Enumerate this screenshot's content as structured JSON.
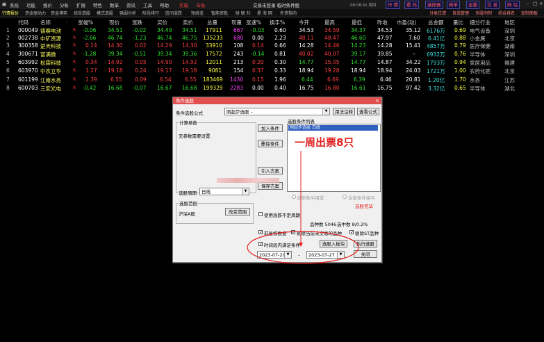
{
  "menu": {
    "items": [
      "系统",
      "功能",
      "报价",
      "分析",
      "扩展",
      "特色",
      "数单",
      "资讯",
      "工具",
      "帮助"
    ],
    "highlight": [
      "实现",
      "市场"
    ],
    "title": "交易未登录 临时条件股",
    "time": "08:08:41 周四",
    "buttons": [
      "行 情",
      "委 托",
      "选择器",
      "新单",
      "全量",
      "交 易",
      "网 站"
    ]
  },
  "tabs": {
    "left": [
      "行情报价",
      "资金驱动力",
      "资金博弈",
      "综合选股",
      "模式选股",
      "强弱分析",
      "阶段排行",
      "区间涨跌",
      "短线宝",
      "智能审批",
      "财 联 社",
      "星 海 网",
      "外资指向"
    ],
    "right": [
      "分类过滤",
      "自选管理",
      "多股同列",
      "综合排名",
      "定制面板"
    ]
  },
  "table": {
    "headers": [
      "代码",
      "名称",
      "·",
      "涨幅%",
      "现价",
      "涨跌",
      "买价",
      "卖价",
      "总量",
      "现量",
      "涨速%",
      "换手%",
      "今开",
      "最高",
      "最低",
      "昨收",
      "市盈(动)",
      "总金额",
      "量比",
      "细分行业",
      "地区"
    ],
    "rows": [
      {
        "idx": "1",
        "code": "000049",
        "name": "德赛电池",
        "r": "R",
        "chg_pct": "-0.06",
        "price": "34.51",
        "chg": "-0.02",
        "bid": "34.49",
        "ask": "34.51",
        "vol": "17911",
        "cur": "667",
        "speed": "-0.03",
        "turnover": "0.60",
        "open": "34.53",
        "high": "34.59",
        "low": "34.37",
        "prev": "34.53",
        "pe": "35.12",
        "amount": "6176万",
        "vr": "0.69",
        "industry": "电气设备",
        "region": "深圳"
      },
      {
        "idx": "2",
        "code": "002738",
        "name": "中矿资源",
        "r": "R",
        "chg_pct": "-2.66",
        "price": "46.74",
        "chg": "-1.23",
        "bid": "46.74",
        "ask": "46.75",
        "vol": "135233",
        "cur": "680",
        "speed": "0.00",
        "turnover": "2.23",
        "open": "48.11",
        "high": "48.47",
        "low": "46.60",
        "prev": "47.97",
        "pe": "7.60",
        "amount": "6.41亿",
        "vr": "0.88",
        "industry": "小金属",
        "region": "北京"
      },
      {
        "idx": "3",
        "code": "300358",
        "name": "楚天科技",
        "r": "R",
        "chg_pct": "0.14",
        "price": "14.30",
        "chg": "0.02",
        "bid": "14.29",
        "ask": "14.30",
        "vol": "33910",
        "cur": "108",
        "speed": "0.14",
        "turnover": "0.66",
        "open": "14.28",
        "high": "14.46",
        "low": "14.23",
        "prev": "14.28",
        "pe": "15.41",
        "amount": "4857万",
        "vr": "0.79",
        "industry": "医疗保健",
        "region": "湖南"
      },
      {
        "idx": "4",
        "code": "300671",
        "name": "富满微",
        "r": "R",
        "chg_pct": "-1.28",
        "price": "39.34",
        "chg": "-0.51",
        "bid": "39.34",
        "ask": "39.36",
        "vol": "17572",
        "cur": "243",
        "speed": "-0.14",
        "turnover": "0.81",
        "open": "40.02",
        "high": "40.07",
        "low": "39.17",
        "prev": "39.85",
        "pe": "–",
        "amount": "6932万",
        "vr": "0.76",
        "industry": "半导体",
        "region": "深圳"
      },
      {
        "idx": "5",
        "code": "603992",
        "name": "松霖科技",
        "r": "R",
        "chg_pct": "0.34",
        "price": "14.92",
        "chg": "0.05",
        "bid": "14.90",
        "ask": "14.92",
        "vol": "12011",
        "cur": "213",
        "speed": "0.20",
        "turnover": "0.30",
        "open": "14.77",
        "high": "15.05",
        "low": "14.77",
        "prev": "14.87",
        "pe": "34.22",
        "amount": "1793万",
        "vr": "0.94",
        "industry": "家居用品",
        "region": "福建"
      },
      {
        "idx": "6",
        "code": "603970",
        "name": "中农立华",
        "r": "R",
        "chg_pct": "1.27",
        "price": "19.18",
        "chg": "0.24",
        "bid": "19.17",
        "ask": "19.18",
        "vol": "9081",
        "cur": "154",
        "speed": "0.37",
        "turnover": "0.33",
        "open": "18.94",
        "high": "19.28",
        "low": "18.94",
        "prev": "18.94",
        "pe": "24.03",
        "amount": "1721万",
        "vr": "1.00",
        "industry": "农药化肥",
        "region": "北京"
      },
      {
        "idx": "7",
        "code": "601199",
        "name": "江南水务",
        "r": "R",
        "chg_pct": "1.39",
        "price": "6.55",
        "chg": "0.09",
        "bid": "6.54",
        "ask": "6.55",
        "vol": "183469",
        "cur": "1430",
        "speed": "0.15",
        "turnover": "1.96",
        "open": "6.44",
        "high": "6.69",
        "low": "6.39",
        "prev": "6.46",
        "pe": "20.81",
        "amount": "1.20亿",
        "vr": "1.70",
        "industry": "水务",
        "region": "江苏"
      },
      {
        "idx": "8",
        "code": "600703",
        "name": "三安光电",
        "r": "R",
        "chg_pct": "-0.42",
        "price": "16.68",
        "chg": "-0.07",
        "bid": "16.67",
        "ask": "16.68",
        "vol": "199329",
        "cur": "2283",
        "speed": "0.00",
        "turnover": "0.40",
        "open": "16.75",
        "high": "16.80",
        "low": "16.61",
        "prev": "16.75",
        "pe": "97.42",
        "amount": "3.32亿",
        "vr": "0.65",
        "industry": "半导体",
        "region": "湖北"
      }
    ]
  },
  "dialog": {
    "title": "条件选股",
    "formula_label": "条件选股公式",
    "formula_value": "刚起步选股 –",
    "btn_usage": "用法注释",
    "btn_view": "查看公式",
    "params_group": "计算参数",
    "params_text": "无参数需要设置",
    "btn_add": "加入条件",
    "btn_delete": "删除条件",
    "btn_import": "引入方案",
    "btn_save": "保存方案",
    "conditions_label": "选股条件列表",
    "condition_item": "刚起步选股 日线",
    "annotation": "一周出票8只",
    "period_label": "选股周期",
    "period_value": "日线",
    "radio_all": "全部条件相与",
    "radio_any": "全部条件相或",
    "status_done": "选股完毕",
    "range_group": "选股范围",
    "range_value": "沪深A股",
    "btn_range": "改变范围",
    "chk_uncertain": "使用涨跌不定周期",
    "total_label": "品种数 5046",
    "selected_label": "选中数 8/0.2%",
    "chk_pre": "前复权数据",
    "chk_exclude_untraded": "剔除当前未交易的品种",
    "chk_exclude_st": "剔除ST品种",
    "chk_time": "时间段内满足条件",
    "btn_to_block": "选股入板块",
    "btn_run": "执行选股",
    "date_from": "2023-07-20",
    "date_sep": "–",
    "date_to": "2023-07-27",
    "btn_close": "关闭",
    "colors": {
      "title_bar": "#e05050",
      "annotation": "#e02020",
      "circle": "#e02020"
    }
  }
}
